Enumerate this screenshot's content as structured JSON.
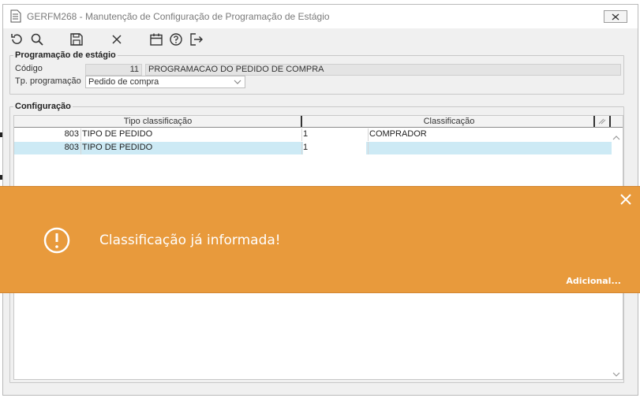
{
  "window": {
    "title": "GERFM268 - Manutenção de Configuração de Programação de Estágio"
  },
  "toolbar": {
    "buttons": [
      {
        "name": "refresh",
        "icon": "refresh-icon"
      },
      {
        "name": "search",
        "icon": "search-icon"
      },
      {
        "name": "save",
        "icon": "save-icon"
      },
      {
        "name": "cancel",
        "icon": "close-icon"
      },
      {
        "name": "calendar",
        "icon": "calendar-icon"
      },
      {
        "name": "help",
        "icon": "help-icon"
      },
      {
        "name": "exit",
        "icon": "exit-icon"
      }
    ]
  },
  "programacao": {
    "group_label": "Programação de estágio",
    "codigo_label": "Código",
    "codigo_value": "11",
    "descricao_value": "PROGRAMACAO DO PEDIDO DE COMPRA",
    "tipo_label": "Tp. programação",
    "tipo_value": "Pedido de compra"
  },
  "configuracao": {
    "group_label": "Configuração",
    "columns": [
      "Tipo classificação",
      "Classificação"
    ],
    "rows": [
      {
        "tipo_code": "803",
        "tipo_desc": "TIPO DE PEDIDO",
        "class_code": "1",
        "class_desc": "COMPRADOR",
        "selected": false
      },
      {
        "tipo_code": "803",
        "tipo_desc": "TIPO DE PEDIDO",
        "class_code": "1",
        "class_desc": "",
        "selected": true
      }
    ]
  },
  "toast": {
    "message": "Classificação já informada!",
    "more_label": "Adicional...",
    "color": "#e89a3c"
  }
}
